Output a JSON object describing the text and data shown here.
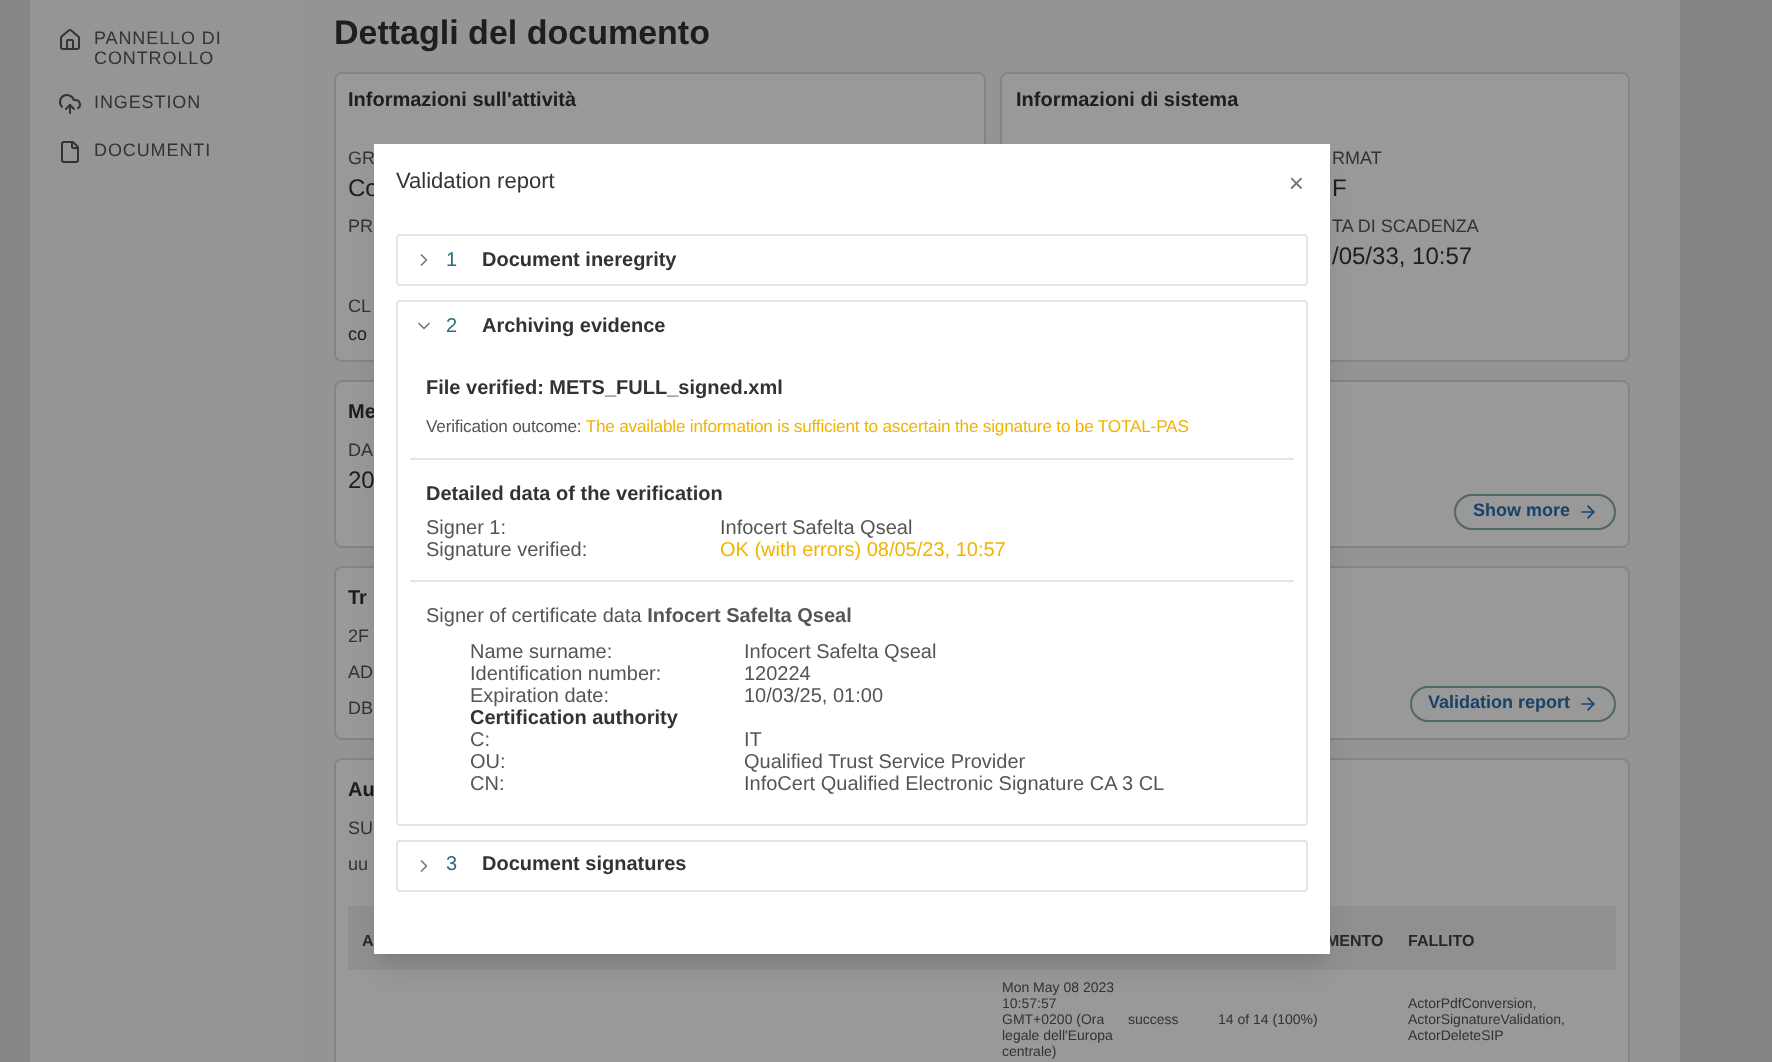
{
  "sidebar": {
    "items": [
      {
        "kind": "home",
        "label": "PANNELLO DI CONTROLLO"
      },
      {
        "kind": "upload",
        "label": "INGESTION"
      },
      {
        "kind": "document",
        "label": "DOCUMENTI"
      }
    ]
  },
  "page": {
    "title": "Dettagli del documento"
  },
  "activity_card": {
    "title": "Informazioni sull'attività",
    "fragments": [
      {
        "kind": "label",
        "text": "GR"
      },
      {
        "kind": "value",
        "text": "Co"
      },
      {
        "kind": "label",
        "text": "PR"
      },
      {
        "kind": "gap"
      },
      {
        "kind": "label",
        "text": "CL"
      },
      {
        "kind": "small",
        "text": "co"
      }
    ]
  },
  "system_card": {
    "title": "Informazioni di sistema",
    "fragments": [
      {
        "kind": "label",
        "text": "RMAT"
      },
      {
        "kind": "value",
        "text": "F"
      },
      {
        "kind": "label",
        "text": "TA DI SCADENZA"
      },
      {
        "kind": "value",
        "text": "/05/33, 10:57"
      }
    ]
  },
  "cards": [
    {
      "title": "Me",
      "fragments": [
        {
          "kind": "label",
          "text": "DA"
        },
        {
          "kind": "value",
          "text": "20"
        }
      ],
      "button": "Show more"
    },
    {
      "title": "Tr",
      "fragments": [
        {
          "kind": "label",
          "text": "2F"
        },
        {
          "kind": "label",
          "text": "AD"
        },
        {
          "kind": "label",
          "text": "DB"
        }
      ],
      "button": "Validation report"
    }
  ],
  "audit_card": {
    "title": "Au",
    "fragments": [
      {
        "kind": "label",
        "text": "SU"
      },
      {
        "kind": "label",
        "text": "uu"
      }
    ],
    "columns": [
      "A",
      "MENTO",
      "FALLITO"
    ],
    "row": [
      "Mon May 08 2023 10:57:57 GMT+0200 (Ora legale dell'Europa centrale)",
      "success",
      "14 of 14 (100%)",
      "ActorPdfConversion, ActorSignatureValidation, ActorDeleteSIP"
    ]
  },
  "modal": {
    "title": "Validation report",
    "close": "×",
    "sections": [
      {
        "number": "1",
        "title": "Document ineregrity",
        "expanded": false
      },
      {
        "number": "2",
        "title": "Archiving evidence",
        "expanded": true,
        "file_verified": "File verified: METS_FULL_signed.xml",
        "outcome_label": "Verification outcome:",
        "outcome_value": "The available information is sufficient to ascertain the signature to be TOTAL-PAS",
        "details_title": "Detailed data of the verification",
        "details_rows": [
          {
            "kind": "plain",
            "label": "Signer 1:",
            "value": "Infocert Safelta Qseal"
          },
          {
            "kind": "warning",
            "label": "Signature verified:",
            "value": "OK (with errors) 08/05/23, 10:57"
          }
        ],
        "certificate_title": "Signer of certificate data **Infocert Safelta Qseal**",
        "certificate_rows": [
          {
            "kind": "plain",
            "label": "Name surname:",
            "value": "Infocert Safelta Qseal"
          },
          {
            "kind": "plain",
            "label": "Identification number:",
            "value": "120224"
          },
          {
            "kind": "plain",
            "label": "Expiration date:",
            "value": "10/03/25, 01:00"
          },
          {
            "kind": "heading",
            "label": "Certification authority"
          },
          {
            "kind": "plain",
            "label": "C:",
            "value": "IT"
          },
          {
            "kind": "plain",
            "label": "OU:",
            "value": "Qualified Trust Service Provider"
          },
          {
            "kind": "plain",
            "label": "CN:",
            "value": "InfoCert Qualified Electronic Signature CA 3 CL"
          }
        ]
      },
      {
        "number": "3",
        "title": "Document signatures",
        "expanded": false
      }
    ]
  }
}
